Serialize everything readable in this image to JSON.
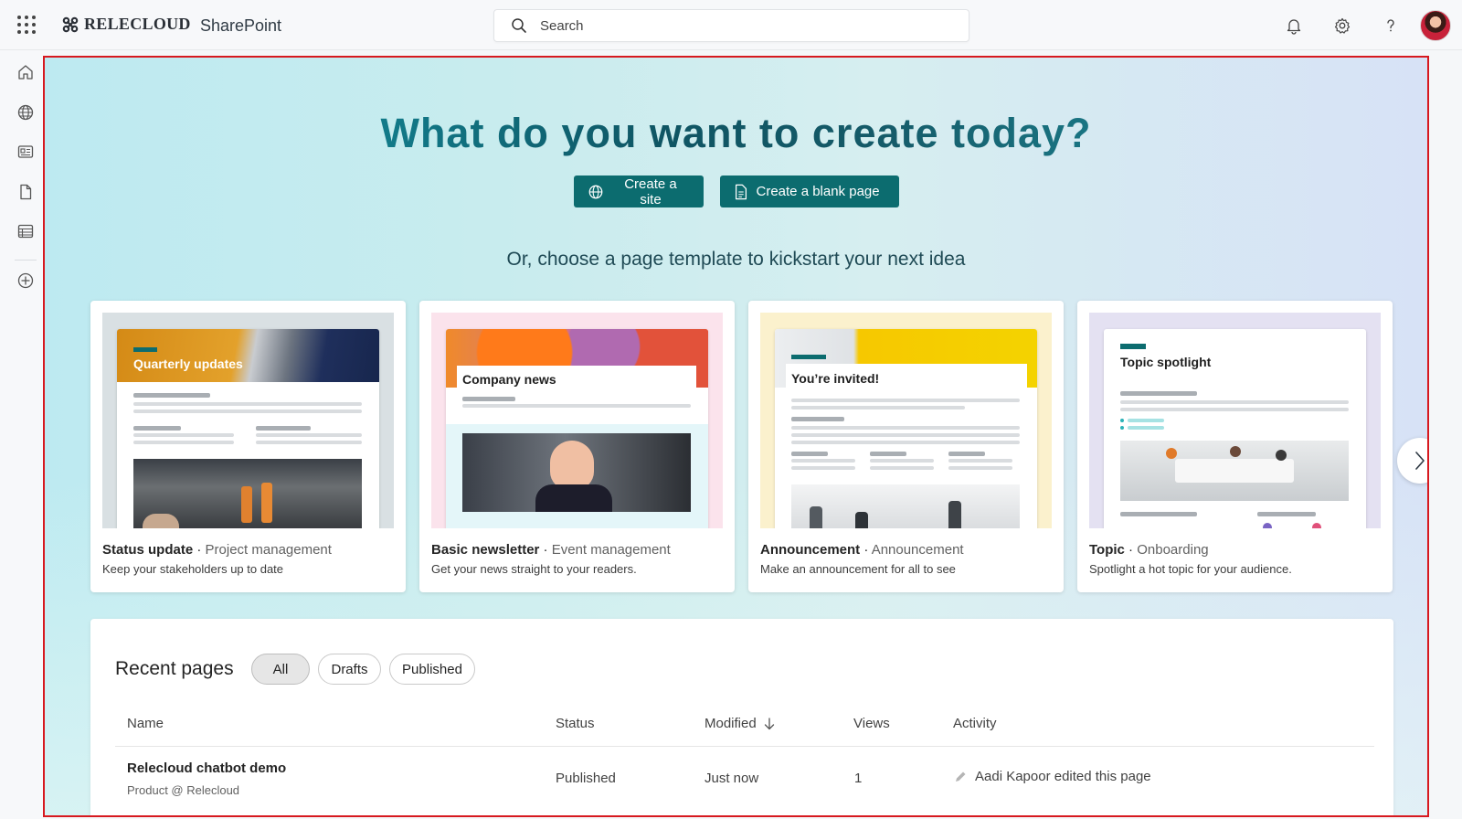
{
  "topbar": {
    "brand": "RELECLOUD",
    "app": "SharePoint",
    "search_placeholder": "Search"
  },
  "hero": {
    "title": "What do you want to create today?",
    "create_site": "Create a site",
    "create_page": "Create a blank page",
    "subtitle": "Or, choose a page template to kickstart your next idea"
  },
  "templates": [
    {
      "name": "Status update",
      "category": "Project management",
      "description": "Keep your stakeholders up to date",
      "banner": "Quarterly updates"
    },
    {
      "name": "Basic newsletter",
      "category": "Event management",
      "description": "Get your news straight to your readers.",
      "banner": "Company news"
    },
    {
      "name": "Announcement",
      "category": "Announcement",
      "description": "Make an announcement for all to see",
      "banner": "You’re invited!"
    },
    {
      "name": "Topic",
      "category": "Onboarding",
      "description": "Spotlight a hot topic for your audience.",
      "banner": "Topic spotlight"
    }
  ],
  "recent": {
    "title": "Recent pages",
    "filters": [
      "All",
      "Drafts",
      "Published"
    ],
    "columns": [
      "Name",
      "Status",
      "Modified",
      "Views",
      "Activity"
    ],
    "rows": [
      {
        "name": "Relecloud chatbot demo",
        "site": "Product @ Relecloud",
        "status": "Published",
        "modified": "Just now",
        "views": "1",
        "activity": "Aadi Kapoor edited this page"
      }
    ]
  },
  "colors": {
    "accent": "#0c6c6f",
    "frame": "#d7191f"
  }
}
